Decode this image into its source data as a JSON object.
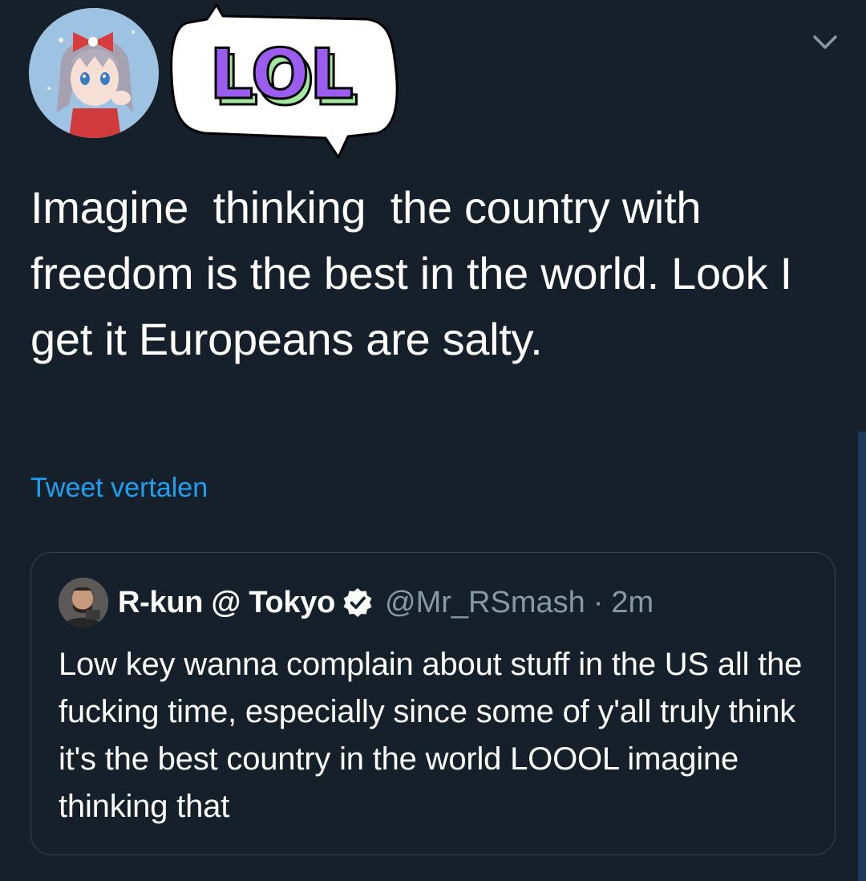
{
  "tweet": {
    "author_avatar_icon": "anime-avatar-icon",
    "reaction_sticker": {
      "icon": "lol-speech-bubble-icon",
      "text": "LOL",
      "colors": {
        "fill": "#9b5cf0",
        "side": "#a3e7a0",
        "outline": "#000000",
        "bubble": "#ffffff"
      }
    },
    "menu_icon": "chevron-down-icon",
    "text": "Imagine  thinking  the country with freedom is the best in the world. Look I get it Europeans are salty.",
    "translate_label": "Tweet vertalen"
  },
  "quoted_tweet": {
    "avatar_icon": "user-avatar-icon",
    "name": "R-kun @ Tokyo",
    "verified_icon": "verified-badge-icon",
    "handle": "@Mr_RSmash",
    "separator": "·",
    "time": "2m",
    "text": "Low key wanna complain about stuff in the US all the fucking time, especially since some of y'all truly think it's the best country in the world LOOOL imagine thinking that"
  },
  "colors": {
    "background": "#15202b",
    "text": "#ffffff",
    "link": "#1da1f2",
    "secondary_text": "#8899a6",
    "card_border": "#38444d"
  }
}
